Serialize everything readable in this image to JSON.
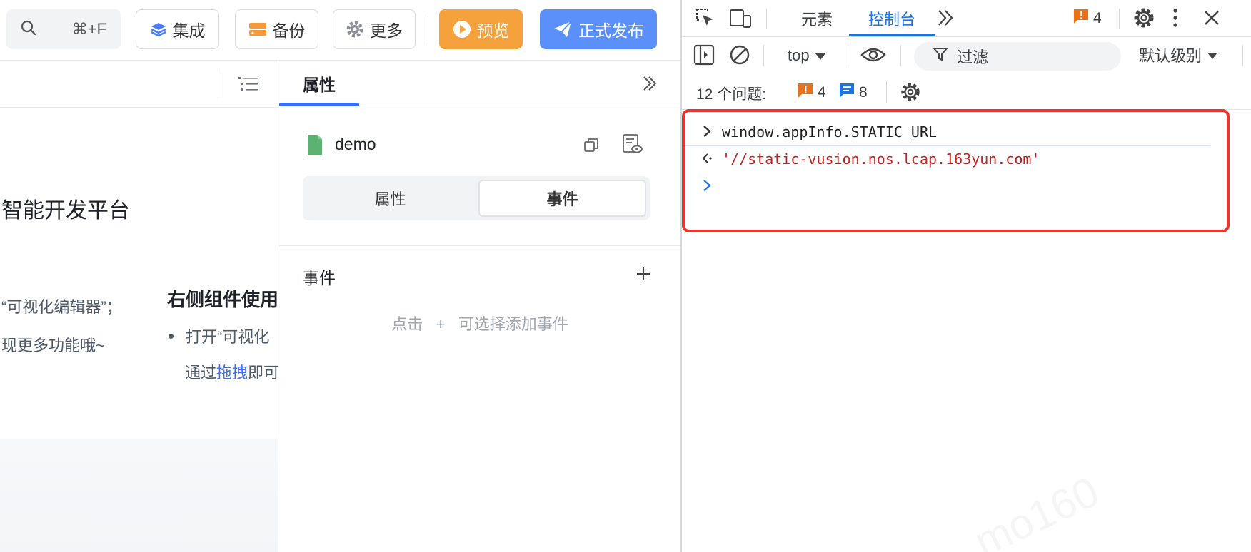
{
  "topbar": {
    "search_shortcut": "⌘+F",
    "integrate_label": "集成",
    "backup_label": "备份",
    "more_label": "更多",
    "preview_label": "预览",
    "publish_label": "正式发布"
  },
  "canvas": {
    "title": "智能开发平台",
    "heading": "右侧组件使用",
    "line1": "“可视化编辑器”；",
    "line2": "现更多功能哦~",
    "bullet_text": "打开“可视化",
    "drag_prefix": "通过",
    "drag_link": "拖拽",
    "drag_suffix": "即可"
  },
  "props_panel": {
    "tab_label": "属性",
    "component_name": "demo",
    "seg_props": "属性",
    "seg_events": "事件",
    "events_label": "事件",
    "hint_prefix": "点击",
    "hint_plus": "+",
    "hint_suffix": "可选择添加事件"
  },
  "devtools": {
    "tab_elements": "元素",
    "tab_console": "控制台",
    "issues_badge_count": "4",
    "context": "top",
    "filter_placeholder": "过滤",
    "level": "默认级别",
    "issues_text": "12 个问题:",
    "issues_warn_count": "4",
    "issues_info_count": "8",
    "console_input": "window.appInfo.STATIC_URL",
    "console_result": "'//static-vusion.nos.lcap.163yun.com'"
  },
  "colors": {
    "preview": "#f5a23c",
    "publish": "#5b8ff9",
    "accent": "#1a73e8",
    "highlight": "#e8372c",
    "result_string": "#c5221f"
  },
  "watermark": "mo160"
}
